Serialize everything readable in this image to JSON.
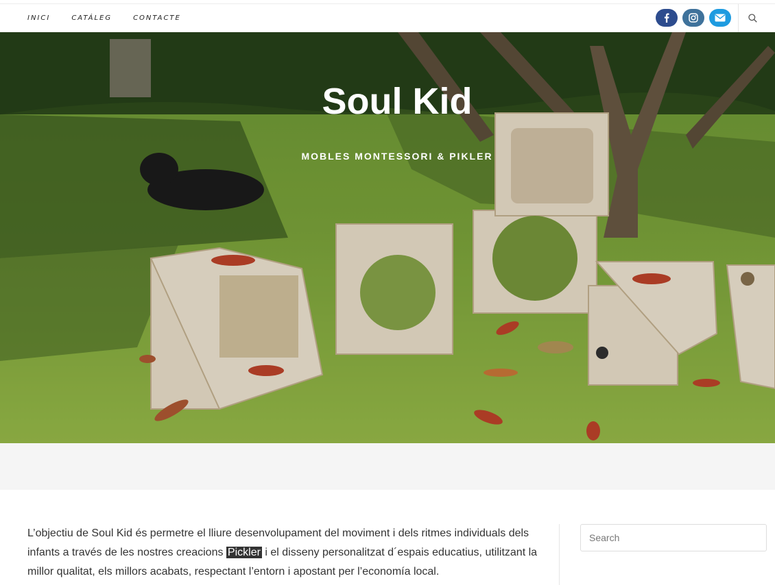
{
  "nav": {
    "items": [
      {
        "label": "Inici"
      },
      {
        "label": "Catáleg"
      },
      {
        "label": "Contacte"
      }
    ]
  },
  "social": {
    "icons": [
      "facebook-icon",
      "instagram-icon",
      "envelope-icon"
    ],
    "colors": {
      "facebook": "#2d4c8e",
      "instagram": "#3f729b",
      "mail": "#1e9be0"
    }
  },
  "hero": {
    "title": "Soul Kid",
    "subtitle": "MOBLES MONTESSORI & PIKLER"
  },
  "content": {
    "text_before": "L’objectiu de Soul Kid és permetre el lliure desenvolupament del moviment i dels ritmes individuals dels infants a través de les nostres creacions ",
    "highlight": "Pickler",
    "text_after": " i el disseny personalitzat d´espais educatius, utilitzant la millor qualitat, els millors acabats, respectant l’entorn i apostant per l’economía local."
  },
  "sidebar": {
    "search_placeholder": "Search"
  }
}
